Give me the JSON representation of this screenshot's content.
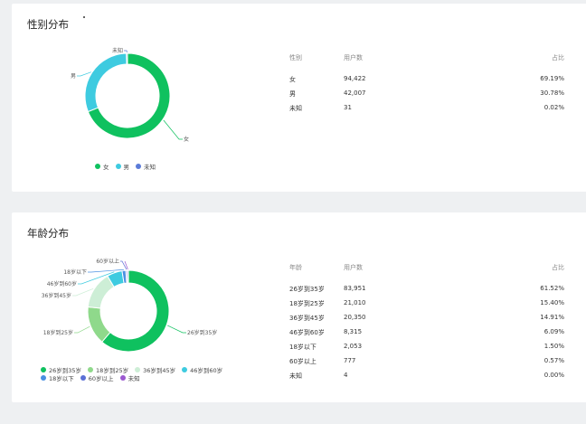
{
  "gender": {
    "title": "性别分布",
    "headers": [
      "性别",
      "用户数",
      "占比"
    ],
    "rows": [
      {
        "label": "女",
        "count": "94,422",
        "pct": "69.19%"
      },
      {
        "label": "男",
        "count": "42,007",
        "pct": "30.78%"
      },
      {
        "label": "未知",
        "count": "31",
        "pct": "0.02%"
      }
    ],
    "legend": [
      {
        "label": "女",
        "color": "#0fc15f"
      },
      {
        "label": "男",
        "color": "#3ecbe0"
      },
      {
        "label": "未知",
        "color": "#5b7bd8"
      }
    ]
  },
  "age": {
    "title": "年龄分布",
    "headers": [
      "年龄",
      "用户数",
      "占比"
    ],
    "rows": [
      {
        "label": "26岁到35岁",
        "count": "83,951",
        "pct": "61.52%"
      },
      {
        "label": "18岁到25岁",
        "count": "21,010",
        "pct": "15.40%"
      },
      {
        "label": "36岁到45岁",
        "count": "20,350",
        "pct": "14.91%"
      },
      {
        "label": "46岁到60岁",
        "count": "8,315",
        "pct": "6.09%"
      },
      {
        "label": "18岁以下",
        "count": "2,053",
        "pct": "1.50%"
      },
      {
        "label": "60岁以上",
        "count": "777",
        "pct": "0.57%"
      },
      {
        "label": "未知",
        "count": "4",
        "pct": "0.00%"
      }
    ],
    "legend": [
      {
        "label": "26岁到35岁",
        "color": "#0fc15f"
      },
      {
        "label": "18岁到25岁",
        "color": "#8fd98b"
      },
      {
        "label": "36岁到45岁",
        "color": "#cdeed6"
      },
      {
        "label": "46岁到60岁",
        "color": "#3ecbe0"
      },
      {
        "label": "18岁以下",
        "color": "#4a90e2"
      },
      {
        "label": "60岁以上",
        "color": "#5b6fd6"
      },
      {
        "label": "未知",
        "color": "#9b59d0"
      }
    ]
  },
  "chart_data": [
    {
      "type": "pie",
      "title": "性别分布",
      "categories": [
        "女",
        "男",
        "未知"
      ],
      "values": [
        94422,
        42007,
        31
      ],
      "colors": [
        "#0fc15f",
        "#3ecbe0",
        "#5b7bd8"
      ],
      "legend": "bottom"
    },
    {
      "type": "pie",
      "title": "年龄分布",
      "categories": [
        "26岁到35岁",
        "18岁到25岁",
        "36岁到45岁",
        "46岁到60岁",
        "18岁以下",
        "60岁以上",
        "未知"
      ],
      "values": [
        83951,
        21010,
        20350,
        8315,
        2053,
        777,
        4
      ],
      "colors": [
        "#0fc15f",
        "#8fd98b",
        "#cdeed6",
        "#3ecbe0",
        "#4a90e2",
        "#5b6fd6",
        "#9b59d0"
      ],
      "legend": "bottom"
    }
  ]
}
